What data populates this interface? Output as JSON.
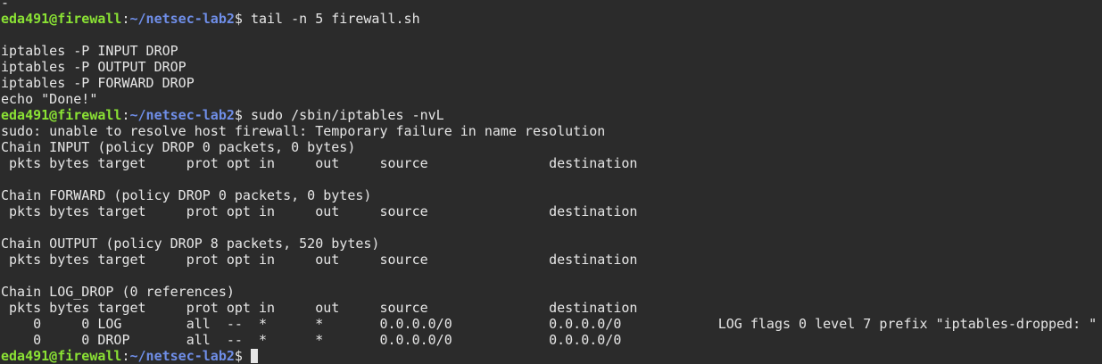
{
  "prompt": {
    "user_host": "eda491@firewall",
    "colon": ":",
    "path": "~/netsec-lab2",
    "dollar": "$ "
  },
  "lines": [
    {
      "type": "text",
      "text": "-"
    },
    {
      "type": "prompt",
      "command": "tail -n 5 firewall.sh"
    },
    {
      "type": "text",
      "text": ""
    },
    {
      "type": "text",
      "text": "iptables -P INPUT DROP"
    },
    {
      "type": "text",
      "text": "iptables -P OUTPUT DROP"
    },
    {
      "type": "text",
      "text": "iptables -P FORWARD DROP"
    },
    {
      "type": "text",
      "text": "echo \"Done!\""
    },
    {
      "type": "prompt",
      "command": "sudo /sbin/iptables -nvL"
    },
    {
      "type": "text",
      "text": "sudo: unable to resolve host firewall: Temporary failure in name resolution"
    },
    {
      "type": "text",
      "text": "Chain INPUT (policy DROP 0 packets, 0 bytes)"
    },
    {
      "type": "text",
      "text": " pkts bytes target     prot opt in     out     source               destination"
    },
    {
      "type": "text",
      "text": ""
    },
    {
      "type": "text",
      "text": "Chain FORWARD (policy DROP 0 packets, 0 bytes)"
    },
    {
      "type": "text",
      "text": " pkts bytes target     prot opt in     out     source               destination"
    },
    {
      "type": "text",
      "text": ""
    },
    {
      "type": "text",
      "text": "Chain OUTPUT (policy DROP 8 packets, 520 bytes)"
    },
    {
      "type": "text",
      "text": " pkts bytes target     prot opt in     out     source               destination"
    },
    {
      "type": "text",
      "text": ""
    },
    {
      "type": "text",
      "text": "Chain LOG_DROP (0 references)"
    },
    {
      "type": "text",
      "text": " pkts bytes target     prot opt in     out     source               destination"
    },
    {
      "type": "text",
      "text": "    0     0 LOG        all  --  *      *       0.0.0.0/0            0.0.0.0/0            LOG flags 0 level 7 prefix \"iptables-dropped: \""
    },
    {
      "type": "text",
      "text": "    0     0 DROP       all  --  *      *       0.0.0.0/0            0.0.0.0/0"
    },
    {
      "type": "prompt",
      "command": "",
      "cursor": true
    }
  ]
}
